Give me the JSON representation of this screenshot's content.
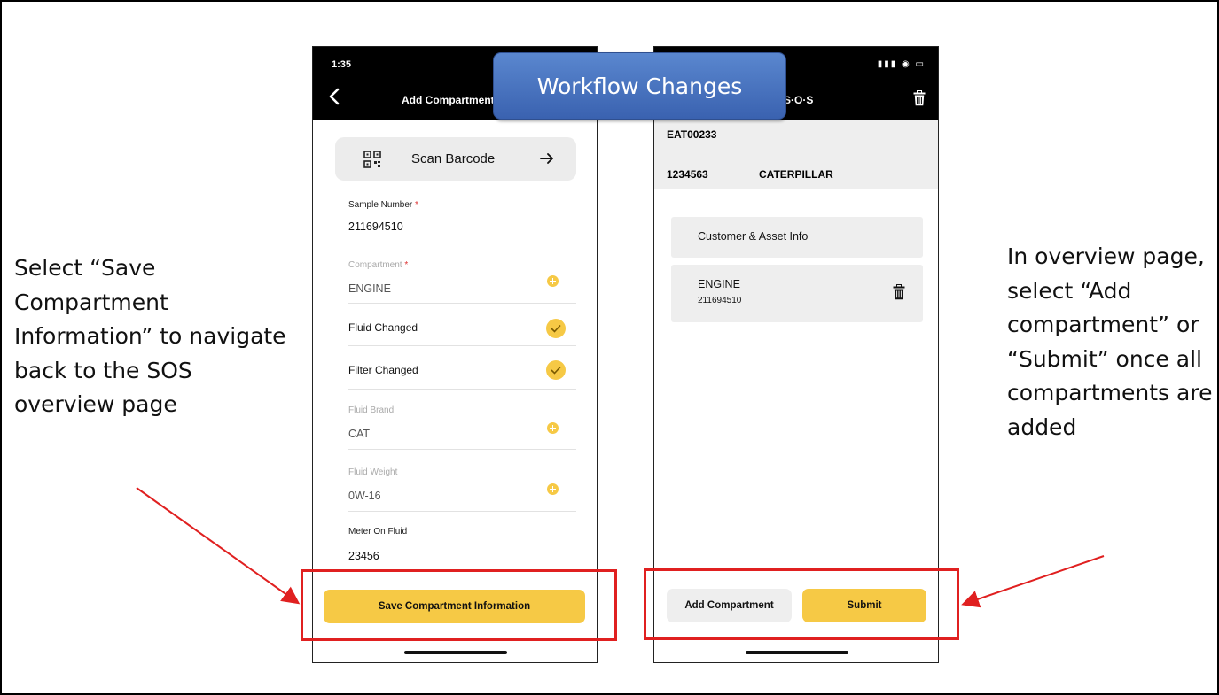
{
  "banner": {
    "title": "Workflow Changes"
  },
  "notes": {
    "left": "Select “Save Compartment Information” to navigate back to the SOS overview page",
    "right": "In overview page, select “Add compartment” or “Submit” once all compartments are added"
  },
  "colors": {
    "accent": "#f6c945",
    "highlight": "#e02020",
    "banner": "#3a62b0"
  },
  "left_screen": {
    "time": "1:35",
    "title": "Add Compartment",
    "scan_label": "Scan Barcode",
    "fields": {
      "sample_number": {
        "label": "Sample Number",
        "value": "211694510"
      },
      "compartment": {
        "label": "Compartment",
        "value": "ENGINE"
      },
      "fluid_changed": {
        "label": "Fluid Changed"
      },
      "filter_changed": {
        "label": "Filter Changed"
      },
      "fluid_brand": {
        "label": "Fluid Brand",
        "value": "CAT"
      },
      "fluid_weight": {
        "label": "Fluid Weight",
        "value": "0W-16"
      },
      "meter_on_fluid": {
        "label": "Meter On Fluid",
        "value": "23456"
      }
    },
    "save_label": "Save Compartment Information"
  },
  "right_screen": {
    "title": "S·O·S",
    "status_icons": "▮▮▮ ◉ ▭",
    "asset_id": "EAT00233",
    "serial": "1234563",
    "make": "CATERPILLAR",
    "customer_item": "Customer & Asset Info",
    "compartment_item": {
      "name": "ENGINE",
      "sample": "211694510"
    },
    "add_label": "Add Compartment",
    "submit_label": "Submit"
  }
}
